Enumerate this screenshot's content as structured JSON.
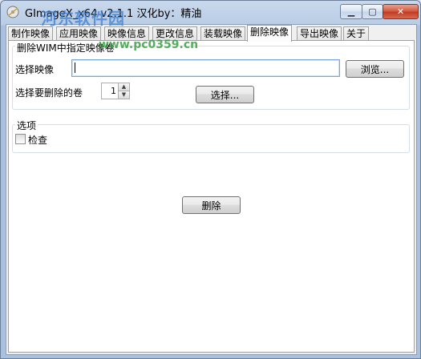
{
  "window": {
    "title": "GImageX_x64 v2.1.1  汉化by：精油",
    "minimize_glyph": "▁",
    "maximize_glyph": "▢",
    "close_glyph": "✕"
  },
  "watermark": {
    "text": "河东软件园",
    "url": "www.pc0359.cn"
  },
  "tabs": [
    {
      "label": "制作映像",
      "active": false
    },
    {
      "label": "应用映像",
      "active": false
    },
    {
      "label": "映像信息",
      "active": false
    },
    {
      "label": "更改信息",
      "active": false
    },
    {
      "label": "装载映像",
      "active": false
    },
    {
      "label": "删除映像",
      "active": true
    },
    {
      "label": "导出映像",
      "active": false
    },
    {
      "label": "关于",
      "active": false
    }
  ],
  "delete_group": {
    "legend": "删除WIM中指定映像卷",
    "image_label": "选择映像",
    "image_value": "",
    "browse_button": "浏览...",
    "volume_label": "选择要删除的卷",
    "volume_value": "1",
    "select_button": "选择..."
  },
  "options_group": {
    "legend": "选项",
    "check_label": "检查",
    "check_checked": false
  },
  "actions": {
    "delete_button": "删除"
  }
}
